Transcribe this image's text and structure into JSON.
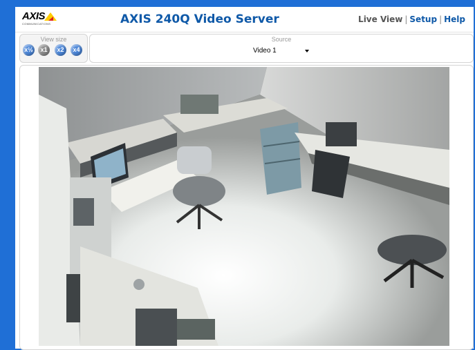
{
  "header": {
    "logo_text": "AXIS",
    "logo_subtext": "COMMUNICATIONS",
    "title": "AXIS 240Q Video Server",
    "nav": {
      "live_view": "Live View",
      "separator": "|",
      "setup": "Setup",
      "help": "Help"
    }
  },
  "view_size": {
    "label": "View size",
    "buttons": [
      {
        "label": "x½",
        "selected": false
      },
      {
        "label": "x1",
        "selected": true
      },
      {
        "label": "x2",
        "selected": false
      },
      {
        "label": "x4",
        "selected": false
      }
    ]
  },
  "source": {
    "label": "Source",
    "selected": "Video 1"
  },
  "video": {
    "description": "Live camera feed"
  },
  "colors": {
    "background": "#1f6fd6",
    "title": "#0f59a8",
    "button_blue": "#4b86d8",
    "button_selected": "#8b8b8b"
  }
}
